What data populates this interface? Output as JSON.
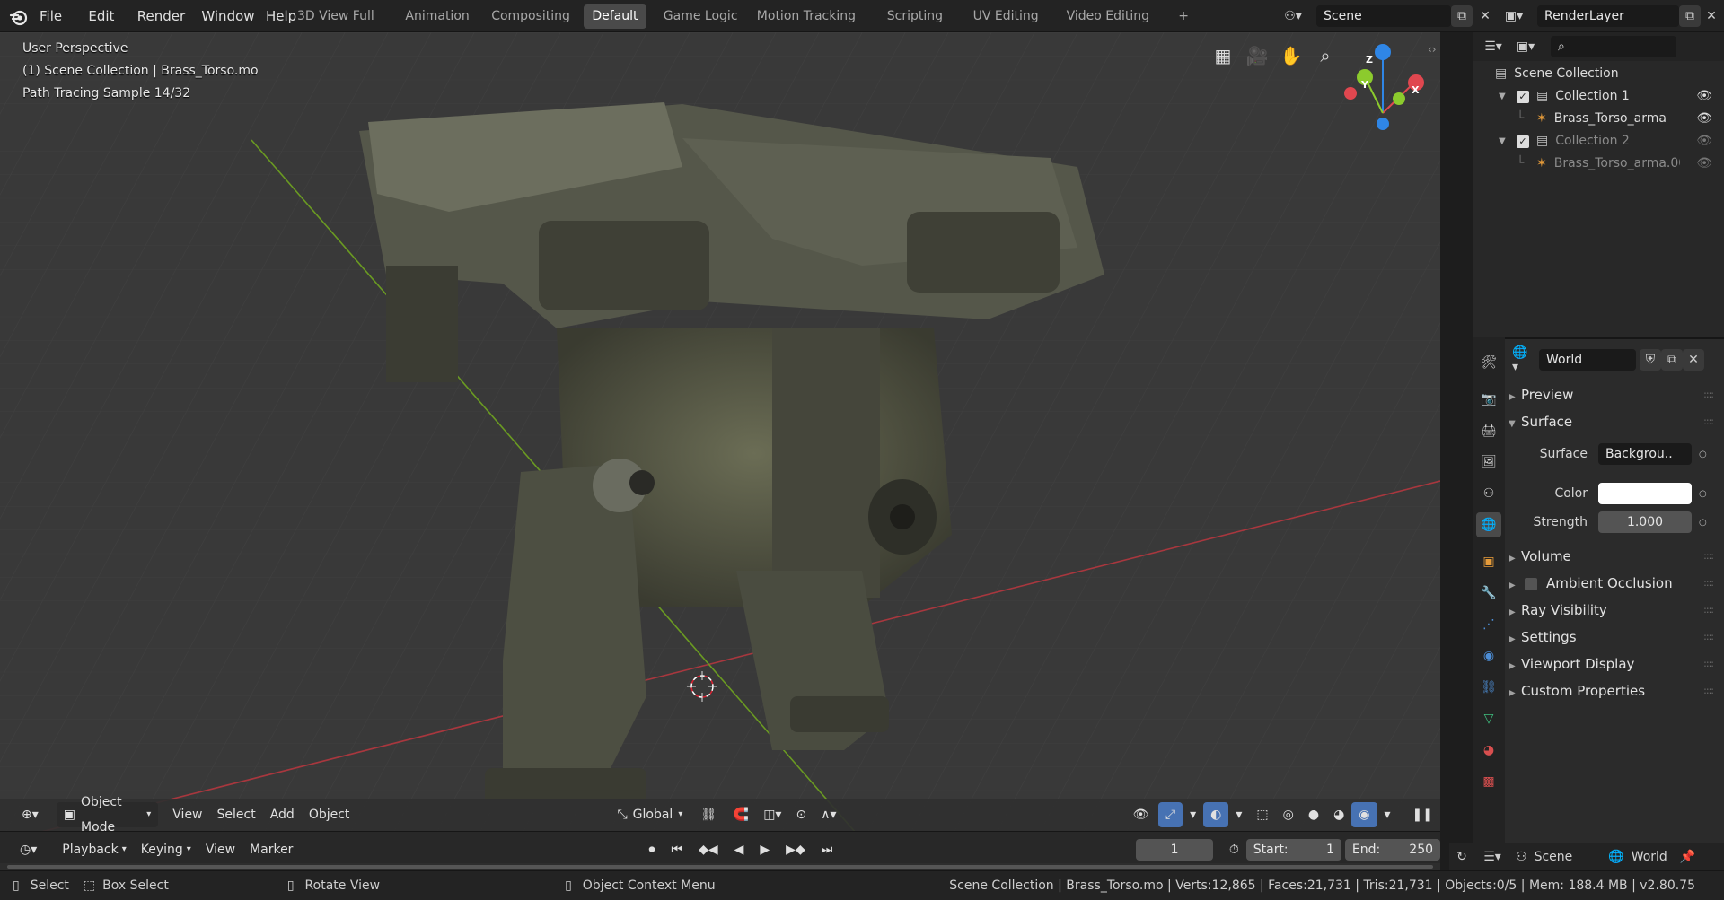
{
  "app": {
    "name": "Blender",
    "version": "v2.80.75"
  },
  "menu": [
    "File",
    "Edit",
    "Render",
    "Window",
    "Help"
  ],
  "workspaces": [
    {
      "label": "3D View Full",
      "active": false
    },
    {
      "label": "Animation",
      "active": false
    },
    {
      "label": "Compositing",
      "active": false
    },
    {
      "label": "Default",
      "active": true
    },
    {
      "label": "Game Logic",
      "active": false
    },
    {
      "label": "Motion Tracking",
      "active": false
    },
    {
      "label": "Scripting",
      "active": false
    },
    {
      "label": "UV Editing",
      "active": false
    },
    {
      "label": "Video Editing",
      "active": false
    }
  ],
  "add_workspace": "+",
  "scene_field": "Scene",
  "view_layer_field": "RenderLayer",
  "viewport": {
    "perspective": "User Perspective",
    "collection_line": "(1) Scene Collection | Brass_Torso.mo",
    "sample_line": "Path Tracing Sample 14/32",
    "gizmo": {
      "x": "X",
      "y": "Y",
      "z": "Z"
    },
    "header": {
      "mode": "Object Mode",
      "menus": [
        "View",
        "Select",
        "Add",
        "Object"
      ],
      "transform_orientation": "Global"
    }
  },
  "outliner": {
    "root": "Scene Collection",
    "items": [
      {
        "label": "Collection 1",
        "type": "collection",
        "indent": 1,
        "expanded": true,
        "checked": true,
        "dim": false
      },
      {
        "label": "Brass_Torso_arma",
        "type": "armature",
        "indent": 2,
        "dim": false
      },
      {
        "label": "Collection 2",
        "type": "collection",
        "indent": 1,
        "expanded": true,
        "checked": true,
        "dim": true
      },
      {
        "label": "Brass_Torso_arma.001",
        "type": "armature",
        "indent": 2,
        "dim": true
      }
    ]
  },
  "properties": {
    "datablock": "World",
    "panels": [
      {
        "label": "Preview",
        "open": false
      },
      {
        "label": "Surface",
        "open": true
      }
    ],
    "surface": {
      "surface_label": "Surface",
      "surface_value": "Backgrou..",
      "color_label": "Color",
      "color_value": "#ffffff",
      "strength_label": "Strength",
      "strength_value": "1.000"
    },
    "more_panels": [
      {
        "label": "Volume",
        "checkbox": false
      },
      {
        "label": "Ambient Occlusion",
        "checkbox": true
      },
      {
        "label": "Ray Visibility",
        "checkbox": false
      },
      {
        "label": "Settings",
        "checkbox": false
      },
      {
        "label": "Viewport Display",
        "checkbox": false
      },
      {
        "label": "Custom Properties",
        "checkbox": false
      }
    ]
  },
  "timeline": {
    "menus": [
      "Playback",
      "Keying",
      "View",
      "Marker"
    ],
    "current_frame": "1",
    "start_label": "Start:",
    "start_value": "1",
    "end_label": "End:",
    "end_value": "250"
  },
  "bottom_right": {
    "scene": "Scene",
    "world": "World"
  },
  "status": {
    "select": "Select",
    "box_select": "Box Select",
    "rotate": "Rotate View",
    "context_menu": "Object Context Menu",
    "stats": "Scene Collection | Brass_Torso.mo | Verts:12,865 | Faces:21,731 | Tris:21,731 | Objects:0/5 | Mem: 188.4 MB | v2.80.75"
  },
  "colors": {
    "accent": "#4772b3",
    "x_axis": "#e0474f",
    "y_axis": "#8ccb2d",
    "z_axis": "#2f86e6"
  }
}
